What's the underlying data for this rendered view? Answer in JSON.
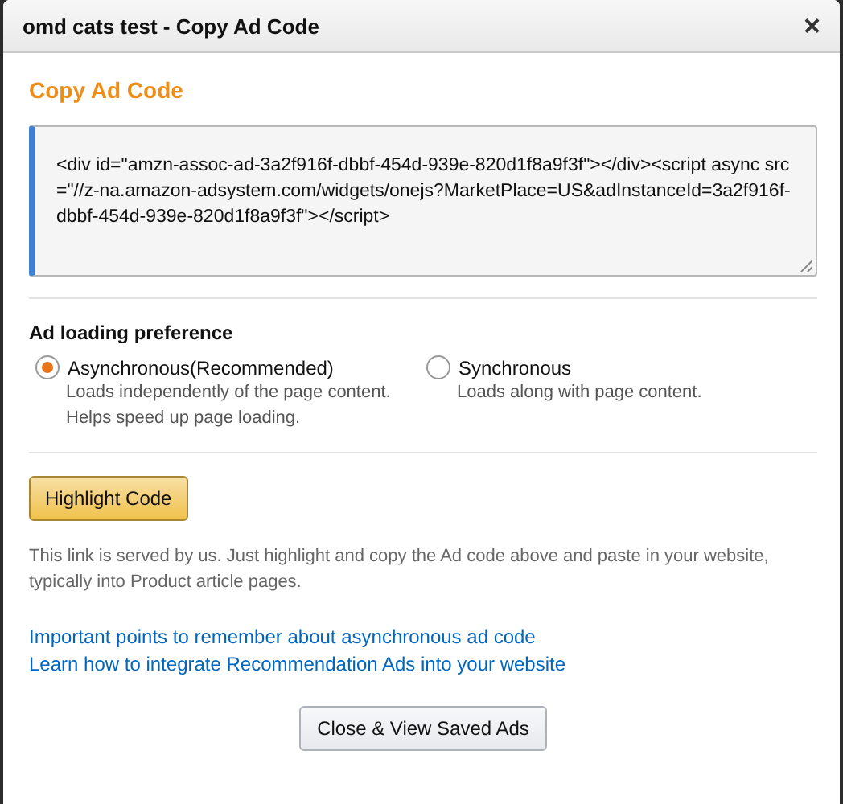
{
  "window": {
    "title": "omd cats test - Copy Ad Code",
    "close": "×"
  },
  "heading": "Copy Ad Code",
  "code": {
    "value": "<div id=\"amzn-assoc-ad-3a2f916f-dbbf-454d-939e-820d1f8a9f3f\"></div><script async src=\"//z-na.amazon-adsystem.com/widgets/onejs?MarketPlace=US&adInstanceId=3a2f916f-dbbf-454d-939e-820d1f8a9f3f\"></script>"
  },
  "loading": {
    "title": "Ad loading preference",
    "options": [
      {
        "label": "Asynchronous(Recommended)",
        "selected": true,
        "description": [
          "Loads independently of the page content.",
          "Helps speed up page loading."
        ]
      },
      {
        "label": "Synchronous",
        "selected": false,
        "description": [
          "Loads along with page content."
        ]
      }
    ]
  },
  "highlight_button": "Highlight Code",
  "note": "This link is served by us. Just highlight and copy the Ad code above and paste in your website, typically into Product article pages.",
  "links": [
    "Important points to remember about asynchronous ad code",
    "Learn how to integrate Recommendation Ads into your website"
  ],
  "close_button": "Close & View Saved Ads"
}
